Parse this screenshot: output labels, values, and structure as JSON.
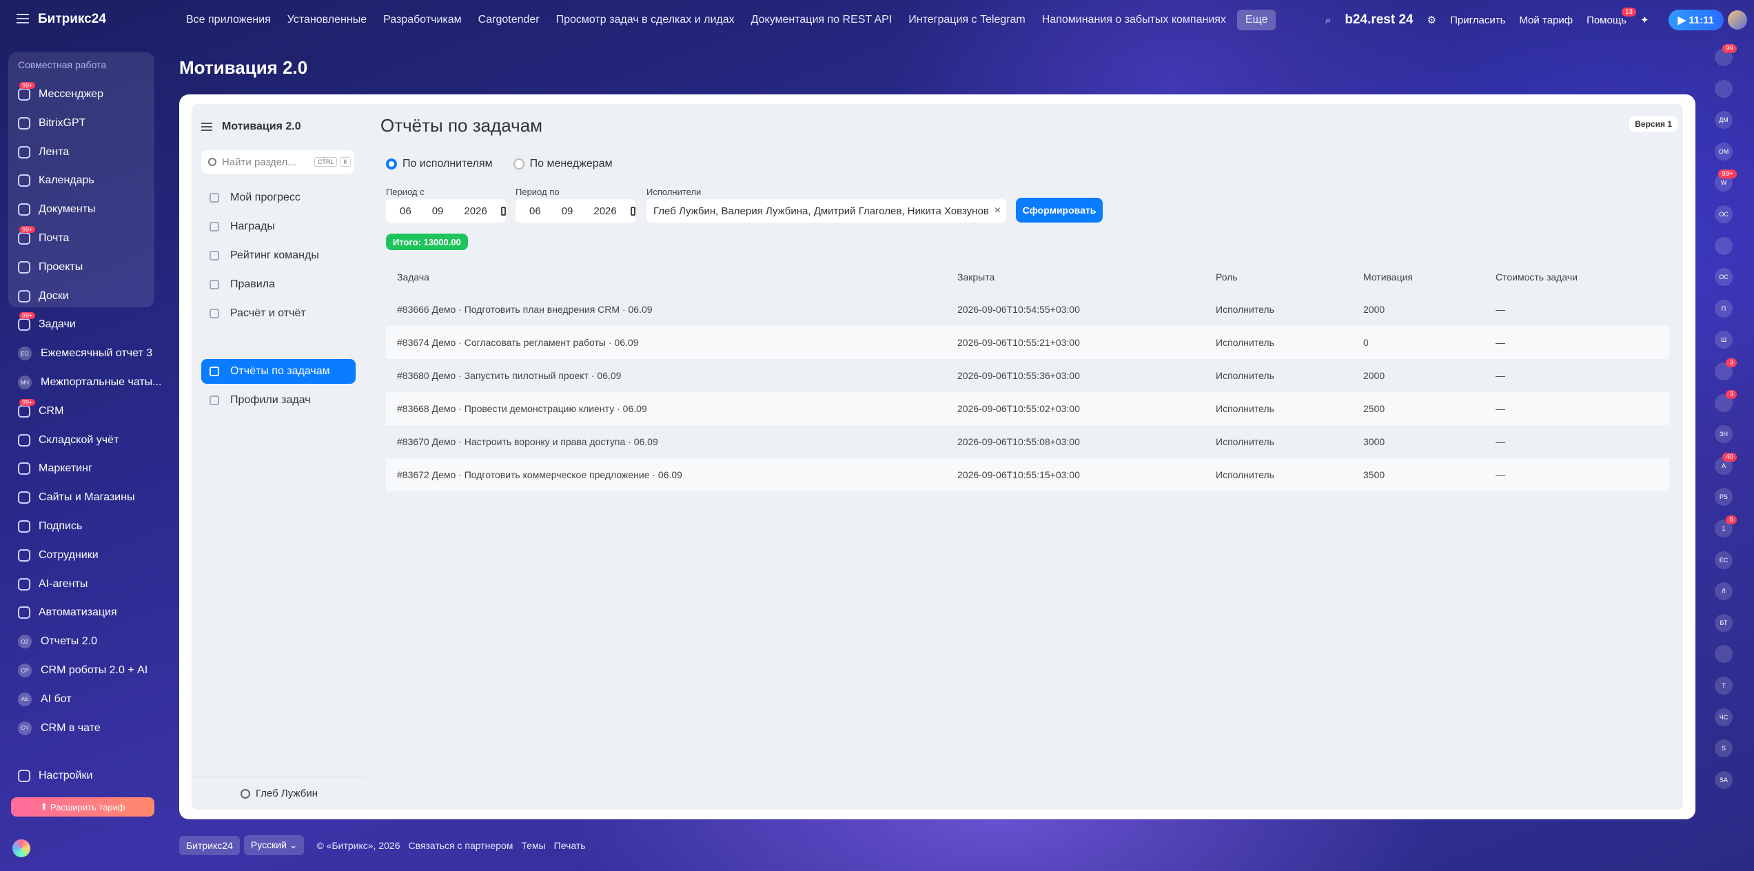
{
  "topbar": {
    "logo": "Битрикс24",
    "nav": [
      "Все приложения",
      "Установленные",
      "Разработчикам",
      "Cargotender",
      "Просмотр задач в сделках и лидах",
      "Документация по REST API",
      "Интеграция с Telegram",
      "Напоминания о забытых компаниях"
    ],
    "more": "Еще",
    "portal": "b24.rest 24",
    "invite": "Пригласить",
    "tariff": "Мой тариф",
    "help": "Помощь",
    "help_badge": "13",
    "time": "11:11"
  },
  "sidebar": {
    "group_header": "Совместная работа",
    "items": [
      {
        "label": "Мессенджер",
        "badge": "99+"
      },
      {
        "label": "BitrixGPT"
      },
      {
        "label": "Лента"
      },
      {
        "label": "Календарь"
      },
      {
        "label": "Документы"
      },
      {
        "label": "Почта",
        "badge": "99+"
      },
      {
        "label": "Проекты"
      },
      {
        "label": "Доски"
      },
      {
        "label": "Задачи",
        "badge": "99+"
      },
      {
        "label": "Ежемесячный отчет 3",
        "abbr": "ЕО"
      },
      {
        "label": "Межпортальные чаты...",
        "abbr": "МЧ"
      },
      {
        "label": "CRM",
        "badge": "99+"
      },
      {
        "label": "Складской учёт"
      },
      {
        "label": "Маркетинг"
      },
      {
        "label": "Сайты и Магазины"
      },
      {
        "label": "Подпись"
      },
      {
        "label": "Сотрудники"
      },
      {
        "label": "AI-агенты"
      },
      {
        "label": "Автоматизация"
      },
      {
        "label": "Отчеты 2.0",
        "abbr": "О2"
      },
      {
        "label": "CRM роботы 2.0 + AI",
        "abbr": "СР"
      },
      {
        "label": "AI бот",
        "abbr": "АБ"
      },
      {
        "label": "CRM в чате",
        "abbr": "СЧ"
      }
    ],
    "settings": "Настройки",
    "upgrade": "Расширить тариф"
  },
  "page": {
    "title": "Мотивация 2.0"
  },
  "app": {
    "title": "Мотивация 2.0",
    "search_placeholder": "Найти раздел...",
    "kbd1": "CTRL",
    "kbd2": "K",
    "nav": [
      "Мой прогресс",
      "Награды",
      "Рейтинг команды",
      "Правила",
      "Расчёт и отчёт",
      "Отчёты по задачам",
      "Профили задач"
    ],
    "active_index": 5,
    "user": "Глеб Лужбин"
  },
  "report": {
    "title": "Отчёты по задачам",
    "version": "Версия 1",
    "radio_performers": "По исполнителям",
    "radio_managers": "По менеджерам",
    "period_from_label": "Период с",
    "period_to_label": "Период по",
    "performers_label": "Исполнители",
    "from": {
      "d": "06",
      "m": "09",
      "y": "2026"
    },
    "to": {
      "d": "06",
      "m": "09",
      "y": "2026"
    },
    "performers": "Глеб Лужбин, Валерия Лужбина, Дмитрий Глаголев, Никита Ховзунов",
    "submit": "Сформировать",
    "total": "Итого: 13000.00",
    "columns": [
      "Задача",
      "Закрыта",
      "Роль",
      "Мотивация",
      "Стоимость задачи"
    ],
    "rows": [
      [
        "#83666 Демо · Подготовить план внедрения CRM · 06.09",
        "2026-09-06T10:54:55+03:00",
        "Исполнитель",
        "2000",
        "—"
      ],
      [
        "#83674 Демо · Согласовать регламент работы · 06.09",
        "2026-09-06T10:55:21+03:00",
        "Исполнитель",
        "0",
        "—"
      ],
      [
        "#83680 Демо · Запустить пилотный проект · 06.09",
        "2026-09-06T10:55:36+03:00",
        "Исполнитель",
        "2000",
        "—"
      ],
      [
        "#83668 Демо · Провести демонстрацию клиенту · 06.09",
        "2026-09-06T10:55:02+03:00",
        "Исполнитель",
        "2500",
        "—"
      ],
      [
        "#83670 Демо · Настроить воронку и права доступа · 06.09",
        "2026-09-06T10:55:08+03:00",
        "Исполнитель",
        "3000",
        "—"
      ],
      [
        "#83672 Демо · Подготовить коммерческое предложение · 06.09",
        "2026-09-06T10:55:15+03:00",
        "Исполнитель",
        "3500",
        "—"
      ]
    ]
  },
  "rail": [
    {
      "abbr": "",
      "badge": "99"
    },
    {
      "abbr": ""
    },
    {
      "abbr": "ДМ"
    },
    {
      "abbr": "ОМ"
    },
    {
      "abbr": "W",
      "badge": "99+"
    },
    {
      "abbr": "ОС"
    },
    {
      "abbr": ""
    },
    {
      "abbr": "ОС"
    },
    {
      "abbr": "П"
    },
    {
      "abbr": "Ш"
    },
    {
      "abbr": "",
      "badge": "3"
    },
    {
      "abbr": "",
      "badge": "3"
    },
    {
      "abbr": "ЗН"
    },
    {
      "abbr": "А",
      "badge": "40"
    },
    {
      "abbr": "PS"
    },
    {
      "abbr": "1",
      "badge": "5"
    },
    {
      "abbr": "ЕС"
    },
    {
      "abbr": "Л"
    },
    {
      "abbr": "БТ"
    },
    {
      "abbr": ""
    },
    {
      "abbr": "Т"
    },
    {
      "abbr": "ЧС"
    },
    {
      "abbr": "S"
    },
    {
      "abbr": "SA"
    }
  ],
  "footer": {
    "brand": "Битрикс24",
    "lang": "Русский",
    "copyright": "© «Битрикс», 2026",
    "partner": "Связаться с партнером",
    "themes": "Темы",
    "print": "Печать"
  },
  "colors": {
    "accent": "#0a7cff",
    "total": "#1fc35b",
    "badge": "#ff3b5c"
  }
}
